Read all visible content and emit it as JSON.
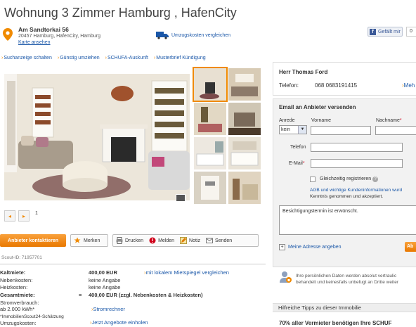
{
  "header": {
    "title": "Wohnung 3 Zimmer Hamburg , HafenCity",
    "address_street": "Am Sandtorkai 56",
    "address_city": "20457 Hamburg, HafenCity, Hamburg",
    "map_link": "Karte ansehen",
    "moving_link": "Umzugskosten vergleichen",
    "fb_like_label": "Gefällt mir",
    "fb_like_count": "0"
  },
  "subnav": [
    "Suchanzeige schalten",
    "Günstig umziehen",
    "SCHUFA-Auskunft",
    "Musterbrief Kündigung"
  ],
  "gallery": {
    "page": "1",
    "prev_icon": "chevron-left-icon",
    "next_icon": "chevron-right-icon"
  },
  "actions": {
    "contact": "Anbieter kontaktieren",
    "save": "Merken",
    "print": "Drucken",
    "report": "Melden",
    "note": "Notiz",
    "send": "Senden"
  },
  "scout_id": "Scout-ID: 71957701",
  "costs": {
    "kaltmiete_label": "Kaltmiete:",
    "kaltmiete_value": "400,00 EUR",
    "mietspiegel_link": "mit lokalem Mietspiegel vergleichen",
    "nebenkosten_label": "Nebenkosten:",
    "nebenkosten_value": "keine Angabe",
    "heizkosten_label": "Heizkosten:",
    "heizkosten_value": "keine Angabe",
    "gesamtmiete_label": "Gesamtmiete:",
    "equals": "=",
    "gesamtmiete_value": "400,00 EUR (zzgl. Nebenkosten & Heizkosten)",
    "strom_label_1": "Stromverbrauch:",
    "strom_label_2": "ab 2.000 kWh*",
    "strom_link": "Stromrechner",
    "umzug_label_1": "*ImmobilienScout24-Schätzung",
    "umzug_label_2": "Umzugskosten:",
    "umzug_link": "Jetzt Angebote einholen"
  },
  "agent": {
    "name": "Herr Thomas Ford",
    "phone_label": "Telefon:",
    "phone_value": "068 0683191415",
    "more_link": "Meh"
  },
  "contact_form": {
    "title": "Email an Anbieter versenden",
    "anrede_label": "Anrede",
    "anrede_value": "kein",
    "vorname_label": "Vorname",
    "nachname_label": "Nachname",
    "telefon_label": "Telefon",
    "email_label": "E-Mail",
    "register_label": "Gleichzeitig registrieren",
    "agb_line1": "AGB und wichtige Kundeninformationen wurd",
    "agb_line2": "Kenntnis genommen und akzeptiert.",
    "message": "Besichtigungstermin ist erwünscht.",
    "address_link": "Meine Adresse angeben",
    "send_button": "Ab",
    "privacy_line1": "Ihre persönlichen Daten werden absolut vertraulic",
    "privacy_line2": "behandelt und keinesfalls unbefugt an Dritte weiter"
  },
  "tips": {
    "header": "Hilfreiche Tipps zu dieser Immobilie",
    "headline": "70% aller Vermieter benötigen Ihre SCHUF"
  },
  "colors": {
    "accent_orange": "#f08a00",
    "link_blue": "#1a57a8"
  }
}
